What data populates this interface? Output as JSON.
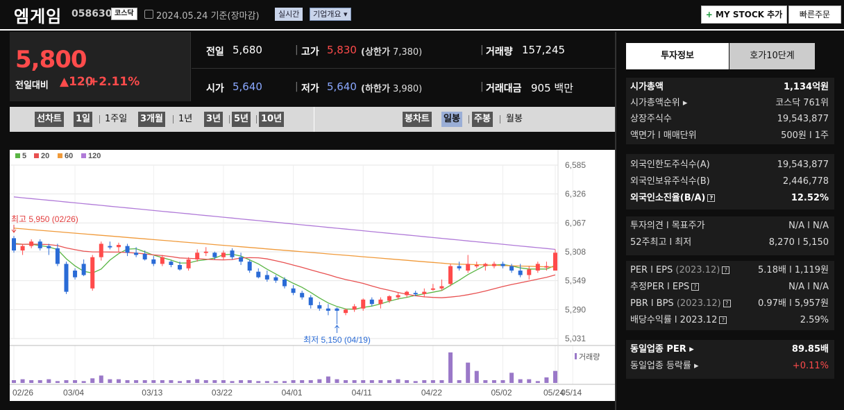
{
  "header": {
    "name": "엠게임",
    "code": "058630",
    "market": "코스닥",
    "date": "2024.05.24",
    "date_suffix": "기준(장마감)",
    "realtime": "실시간",
    "company": "기업개요 ▾",
    "mystock": "MY STOCK 추가",
    "fast_order": "빠른주문"
  },
  "price": {
    "current": "5,800",
    "change_label": "전일대비",
    "change": "▲120",
    "pct": "+2.11%"
  },
  "stats": {
    "prev_label": "전일",
    "prev": "5,680",
    "high_label": "고가",
    "high": "5,830",
    "upper_label": "(상한가",
    "upper": "7,380)",
    "vol_label": "거래량",
    "vol": "157,245",
    "open_label": "시가",
    "open": "5,640",
    "low_label": "저가",
    "low": "5,640",
    "lower_label": "(하한가",
    "lower": "3,980)",
    "amt_label": "거래대금",
    "amt": "905 백만"
  },
  "tabs": {
    "line": "선차트",
    "d1": "1일",
    "w1": "1주일",
    "m3": "3개월",
    "y1": "1년",
    "y3": "3년",
    "y5": "5년",
    "y10": "10년",
    "candle": "봉차트",
    "day": "일봉",
    "week": "주봉",
    "month": "월봉"
  },
  "colors": {
    "up": "#ff4b4b",
    "down": "#2a6bd6",
    "ma5": "#5ab544",
    "ma20": "#e85050",
    "ma60": "#f09a3a",
    "ma120": "#b07ad8",
    "vol": "#9a78c8"
  },
  "chart_data": {
    "type": "candlestick",
    "legend": [
      "5",
      "20",
      "60",
      "120"
    ],
    "y_ticks": [
      "6,585",
      "6,326",
      "6,067",
      "5,808",
      "5,549",
      "5,290",
      "5,031"
    ],
    "ylim": [
      5031,
      6585
    ],
    "x_ticks": [
      "02/26",
      "03/04",
      "03/13",
      "03/22",
      "04/01",
      "04/11",
      "04/22",
      "05/02",
      "05/14",
      "05/24"
    ],
    "high_annotation": "최고 5,950 (02/26)",
    "low_annotation": "최저 5,150 (04/19)",
    "volume_label": "거래량",
    "candles": [
      [
        5930,
        5950,
        5800,
        5820
      ],
      [
        5820,
        5880,
        5780,
        5860
      ],
      [
        5860,
        5920,
        5840,
        5900
      ],
      [
        5900,
        5920,
        5820,
        5840
      ],
      [
        5860,
        5880,
        5780,
        5840
      ],
      [
        5840,
        5880,
        5680,
        5700
      ],
      [
        5700,
        5720,
        5430,
        5450
      ],
      [
        5640,
        5660,
        5560,
        5580
      ],
      [
        5700,
        5740,
        5590,
        5600
      ],
      [
        5480,
        5780,
        5460,
        5760
      ],
      [
        5760,
        5900,
        5730,
        5880
      ],
      [
        5860,
        5900,
        5830,
        5850
      ],
      [
        5850,
        5890,
        5810,
        5870
      ],
      [
        5860,
        5880,
        5770,
        5800
      ],
      [
        5800,
        5850,
        5760,
        5780
      ],
      [
        5790,
        5820,
        5730,
        5740
      ],
      [
        5740,
        5770,
        5680,
        5700
      ],
      [
        5700,
        5780,
        5680,
        5760
      ],
      [
        5720,
        5730,
        5670,
        5690
      ],
      [
        5690,
        5720,
        5640,
        5650
      ],
      [
        5660,
        5760,
        5640,
        5740
      ],
      [
        5740,
        5830,
        5720,
        5800
      ],
      [
        5800,
        5850,
        5770,
        5810
      ],
      [
        5800,
        5810,
        5740,
        5760
      ],
      [
        5760,
        5820,
        5740,
        5800
      ],
      [
        5820,
        5840,
        5740,
        5760
      ],
      [
        5760,
        5800,
        5690,
        5720
      ],
      [
        5720,
        5740,
        5620,
        5640
      ],
      [
        5630,
        5660,
        5570,
        5580
      ],
      [
        5600,
        5640,
        5540,
        5560
      ],
      [
        5580,
        5600,
        5530,
        5550
      ],
      [
        5560,
        5580,
        5480,
        5500
      ],
      [
        5480,
        5510,
        5420,
        5440
      ],
      [
        5440,
        5460,
        5380,
        5400
      ],
      [
        5400,
        5420,
        5300,
        5330
      ],
      [
        5330,
        5360,
        5280,
        5300
      ],
      [
        5300,
        5340,
        5240,
        5280
      ],
      [
        5300,
        5310,
        5160,
        5280
      ],
      [
        5260,
        5300,
        5240,
        5290
      ],
      [
        5290,
        5340,
        5270,
        5320
      ],
      [
        5300,
        5390,
        5280,
        5380
      ],
      [
        5380,
        5400,
        5320,
        5340
      ],
      [
        5340,
        5400,
        5300,
        5380
      ],
      [
        5370,
        5420,
        5350,
        5410
      ],
      [
        5400,
        5440,
        5380,
        5420
      ],
      [
        5420,
        5460,
        5400,
        5450
      ],
      [
        5440,
        5460,
        5410,
        5430
      ],
      [
        5430,
        5480,
        5400,
        5450
      ],
      [
        5470,
        5520,
        5460,
        5480
      ],
      [
        5480,
        5560,
        5460,
        5500
      ],
      [
        5520,
        5700,
        5500,
        5680
      ],
      [
        5680,
        5720,
        5640,
        5660
      ],
      [
        5640,
        5780,
        5620,
        5700
      ],
      [
        5680,
        5720,
        5660,
        5690
      ],
      [
        5680,
        5710,
        5640,
        5700
      ],
      [
        5680,
        5720,
        5660,
        5700
      ],
      [
        5700,
        5720,
        5660,
        5680
      ],
      [
        5680,
        5700,
        5620,
        5640
      ],
      [
        5640,
        5700,
        5580,
        5600
      ],
      [
        5600,
        5680,
        5560,
        5650
      ],
      [
        5640,
        5720,
        5620,
        5700
      ],
      [
        5680,
        5720,
        5640,
        5680
      ],
      [
        5640,
        5830,
        5640,
        5800
      ]
    ],
    "volume": [
      3,
      4,
      3,
      3,
      4,
      2,
      3,
      3,
      2,
      5,
      8,
      4,
      4,
      3,
      3,
      3,
      3,
      3,
      3,
      2,
      3,
      4,
      3,
      3,
      3,
      2,
      3,
      3,
      2,
      2,
      2,
      2,
      3,
      3,
      3,
      4,
      7,
      4,
      3,
      3,
      3,
      3,
      3,
      3,
      4,
      3,
      2,
      3,
      3,
      3,
      33,
      3,
      22,
      13,
      3,
      3,
      3,
      11,
      4,
      4,
      2,
      6,
      13
    ]
  },
  "panel": {
    "tab_on": "투자정보",
    "tab_off": "호가10단계",
    "r1": [
      [
        "시가총액",
        "1,134억원"
      ],
      [
        "시가총액순위 ▸",
        "코스닥 761위"
      ],
      [
        "상장주식수",
        "19,543,877"
      ],
      [
        "액면가 l 매매단위",
        "500원 l 1주"
      ]
    ],
    "r2": [
      [
        "외국인한도주식수(A)",
        "19,543,877"
      ],
      [
        "외국인보유주식수(B)",
        "2,446,778"
      ],
      [
        "외국인소진율(B/A)",
        "12.52%"
      ]
    ],
    "r3": [
      [
        "투자의견 l 목표주가",
        "N/A l N/A"
      ],
      [
        "52주최고 l 최저",
        "8,270 l 5,150"
      ]
    ],
    "r4": [
      [
        "PER l EPS",
        "(2023.12)",
        "5.18배 l 1,119원"
      ],
      [
        "추정PER l EPS",
        "",
        "N/A l N/A"
      ],
      [
        "PBR l BPS",
        "(2023.12)",
        "0.97배 l 5,957원"
      ],
      [
        "배당수익률 l 2023.12",
        "",
        "2.59%"
      ]
    ],
    "r5": [
      [
        "동일업종 PER ▸",
        "89.85배"
      ],
      [
        "동일업종 등락률 ▸",
        "+0.11%"
      ]
    ]
  }
}
